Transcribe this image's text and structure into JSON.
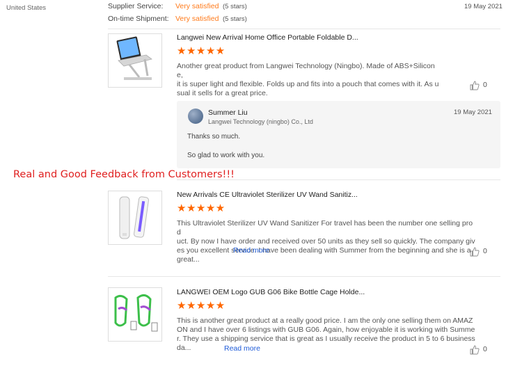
{
  "buyer": {
    "country": "United States"
  },
  "seller_ratings": [
    {
      "label": "Supplier Service:",
      "value": "Very satisfied",
      "stars": "(5 stars)"
    },
    {
      "label": "On-time Shipment:",
      "value": "Very satisfied",
      "stars": "(5 stars)"
    }
  ],
  "top_date": "19 May 2021",
  "overlay_text": "Real and Good Feedback from Customers!!!",
  "reviews": [
    {
      "product_title": "Langwei New Arrival Home Office Portable Foldable D...",
      "stars": "★★★★★",
      "rating": 5,
      "text_lines": [
        "Another great product from Langwei Technology (Ningbo). Made of ABS+Silicone,",
        "it is super light and flexible. Folds up and fits into a pouch that comes with it. As u",
        "sual it sells for a great price."
      ],
      "likes": "0",
      "reply": {
        "name": "Summer Liu",
        "company": "Langwei Technology (ningbo) Co., Ltd",
        "date": "19 May 2021",
        "messages": [
          "Thanks so much.",
          "So glad to work with you."
        ]
      }
    },
    {
      "product_title": "New Arrivals CE Ultraviolet Sterilizer UV Wand Sanitiz...",
      "stars": "★★★★★",
      "rating": 5,
      "text_lines": [
        "This Ultraviolet Sterilizer UV Wand Sanitizer For travel has been the number one selling prod",
        "uct. By now I have order and received over 50 units as they sell so quickly. The company giv",
        "es you excellent service. I have been dealing with Summer from the beginning and she is a",
        "great..."
      ],
      "read_more": "Read more",
      "likes": "0"
    },
    {
      "product_title": "LANGWEI OEM Logo GUB G06 Bike Bottle Cage Holde...",
      "stars": "★★★★★",
      "rating": 5,
      "text_lines": [
        "This is another great product at a really good price. I am the only one selling them on AMAZ",
        "ON and I have over 6 listings with GUB G06. Again, how enjoyable it is working with Summe",
        "r. They use a shipping service that is great as I usually receive the product in 5 to 6 business",
        "da..."
      ],
      "read_more": "Read more",
      "likes": "0"
    }
  ]
}
